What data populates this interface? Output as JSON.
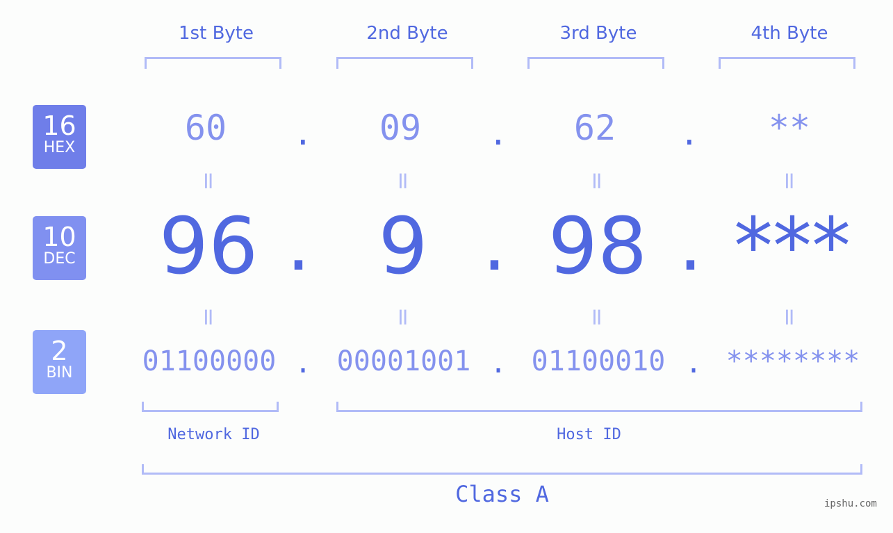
{
  "byte_headers": [
    "1st Byte",
    "2nd Byte",
    "3rd Byte",
    "4th Byte"
  ],
  "badges": {
    "hex": {
      "num": "16",
      "label": "HEX",
      "color": "#6f7ee9"
    },
    "dec": {
      "num": "10",
      "label": "DEC",
      "color": "#8090f0"
    },
    "bin": {
      "num": "2",
      "label": "BIN",
      "color": "#8fa5f8"
    }
  },
  "hex_values": [
    "60",
    "09",
    "62",
    "**"
  ],
  "dec_values": [
    "96",
    "9",
    "98",
    "***"
  ],
  "bin_values": [
    "01100000",
    "00001001",
    "01100010",
    "********"
  ],
  "separator": ".",
  "equals_sign": "=",
  "network_id_label": "Network ID",
  "host_id_label": "Host ID",
  "class_label": "Class A",
  "watermark": "ipshu.com",
  "colors": {
    "accent": "#5068e0",
    "light_value": "#8492ee",
    "bracket": "#b1bbf7"
  }
}
